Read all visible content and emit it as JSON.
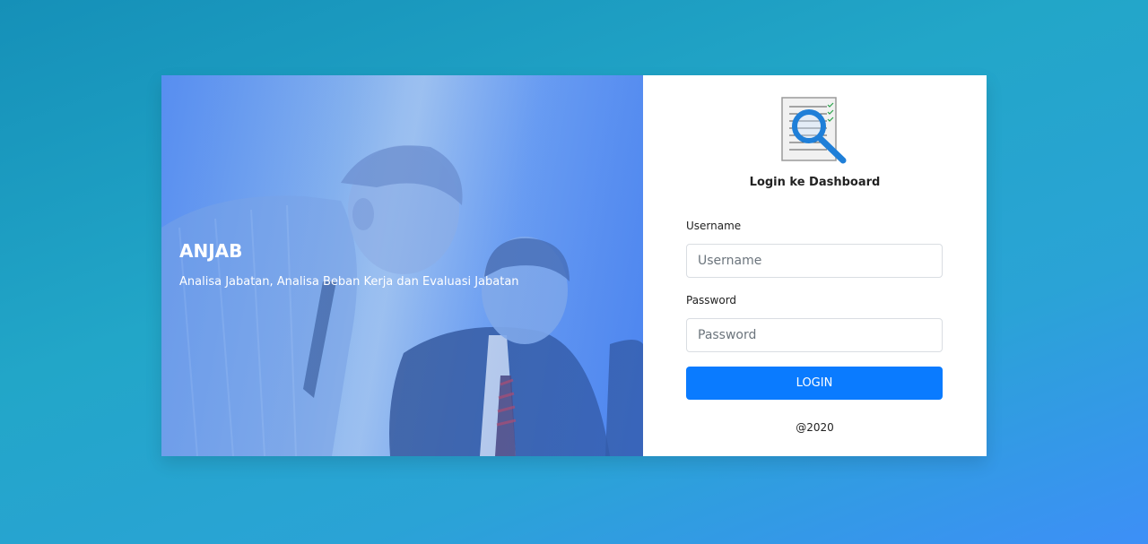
{
  "hero": {
    "title": "ANJAB",
    "subtitle": "Analisa Jabatan, Analisa Beban Kerja dan Evaluasi Jabatan"
  },
  "login": {
    "logo_icon": "document-search-icon",
    "heading": "Login ke Dashboard",
    "username_label": "Username",
    "username_placeholder": "Username",
    "username_value": "",
    "password_label": "Password",
    "password_placeholder": "Password",
    "password_value": "",
    "button_label": "LOGIN",
    "footer": "@2020"
  },
  "colors": {
    "primary_button": "#0a7bff",
    "background_start": "#1590b8",
    "background_end": "#3d8ff7"
  }
}
